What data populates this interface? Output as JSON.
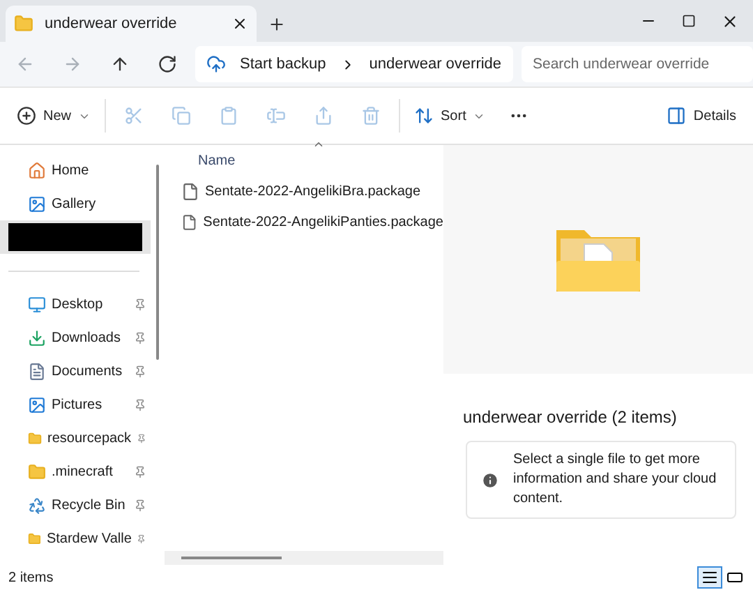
{
  "tab": {
    "title": "underwear override",
    "selected": true
  },
  "address": {
    "breadcrumbs": [
      "Start backup",
      "underwear override"
    ],
    "search": {
      "placeholder": "Search underwear override"
    }
  },
  "nav_buttons": [
    {
      "kind": "back",
      "disabled": true
    },
    {
      "kind": "forward",
      "disabled": true
    },
    {
      "kind": "up",
      "disabled": false
    },
    {
      "kind": "refresh",
      "disabled": false
    }
  ],
  "toolbar": [
    {
      "kind": "new",
      "label": "New",
      "disabled": false
    },
    {
      "kind": "cut",
      "disabled": true
    },
    {
      "kind": "copy",
      "disabled": true
    },
    {
      "kind": "paste",
      "disabled": true
    },
    {
      "kind": "rename",
      "disabled": true
    },
    {
      "kind": "share",
      "disabled": true
    },
    {
      "kind": "delete",
      "disabled": true
    },
    {
      "kind": "sort",
      "label": "Sort",
      "disabled": false
    },
    {
      "kind": "more",
      "disabled": false
    },
    {
      "kind": "details",
      "label": "Details",
      "disabled": false
    }
  ],
  "sidebar": {
    "items": [
      {
        "kind": "home",
        "label": "Home",
        "pinned": false,
        "selected": false
      },
      {
        "kind": "gallery",
        "label": "Gallery",
        "pinned": false,
        "selected": false
      },
      {
        "kind": "redacted",
        "selected": true
      },
      {
        "kind": "desktop",
        "label": "Desktop",
        "pinned": true,
        "selected": false
      },
      {
        "kind": "downloads",
        "label": "Downloads",
        "pinned": true,
        "selected": false
      },
      {
        "kind": "documents",
        "label": "Documents",
        "pinned": true,
        "selected": false
      },
      {
        "kind": "pictures",
        "label": "Pictures",
        "pinned": true,
        "selected": false
      },
      {
        "kind": "folder",
        "label": "resourcepack",
        "pinned": true,
        "selected": false
      },
      {
        "kind": "folder",
        "label": ".minecraft",
        "pinned": true,
        "selected": false
      },
      {
        "kind": "recycle",
        "label": "Recycle Bin",
        "pinned": true,
        "selected": false
      },
      {
        "kind": "folder",
        "label": "Stardew Valle",
        "pinned": true,
        "selected": false
      }
    ]
  },
  "file_list": {
    "columns": [
      "Name"
    ],
    "rows": [
      {
        "name": "Sentate-2022-AngelikiBra.package"
      },
      {
        "name": "Sentate-2022-AngelikiPanties.package"
      }
    ]
  },
  "details_pane": {
    "title": "underwear override (2 items)",
    "info": "Select a single file to get more information and share your cloud content."
  },
  "status_bar": {
    "count": "2 items",
    "views": [
      {
        "kind": "details",
        "selected": true
      },
      {
        "kind": "tiles",
        "selected": false
      }
    ]
  }
}
